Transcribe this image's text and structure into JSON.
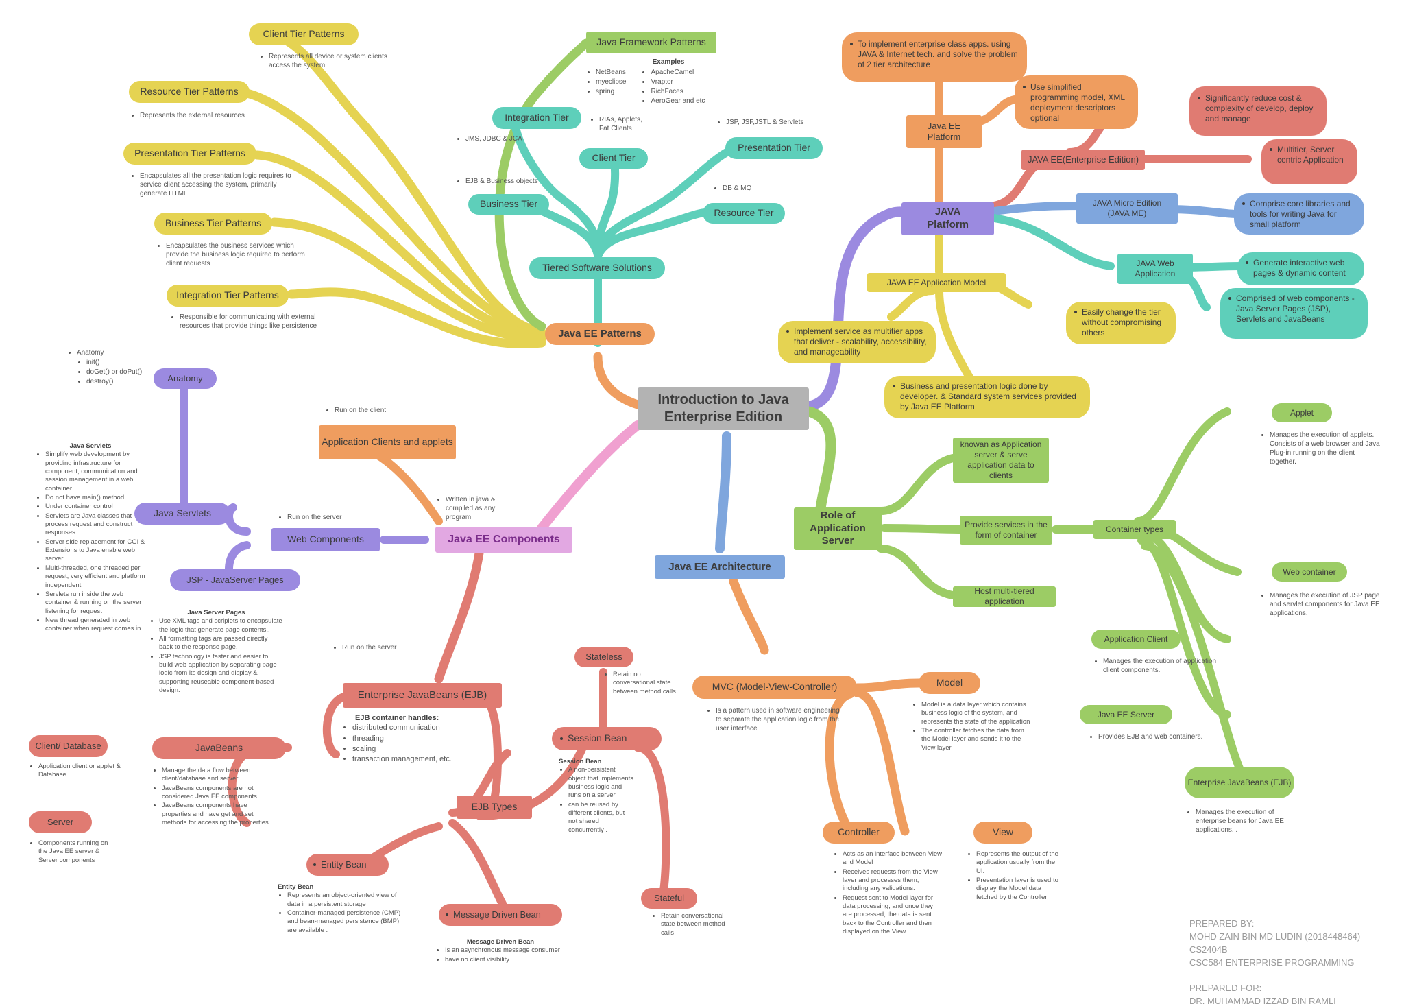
{
  "colors": {
    "yellow": "#e5d352",
    "yellow_soft": "#e4d04a",
    "green": "#9ccc65",
    "green_light": "#a5d46a",
    "teal": "#5ecfba",
    "teal2": "#63cfb8",
    "orange": "#ef9d5f",
    "orange2": "#eea064",
    "red": "#e07b72",
    "purple": "#9b8ae0",
    "purple2": "#a294e6",
    "blue": "#7fa6dd",
    "grey": "#b3b3b3",
    "text": "#3c3c3c",
    "note": "#555555"
  },
  "center": {
    "title": "Introduction to Java\nEnterprise Edition"
  },
  "branches": {
    "java_ee_patterns": {
      "label": "Java EE Patterns",
      "children": [
        {
          "label": "Client Tier Patterns",
          "notes": [
            "Represents all device or system clients access the system"
          ]
        },
        {
          "label": "Resource Tier Patterns",
          "notes": [
            "Represents the external resources"
          ]
        },
        {
          "label": "Presentation Tier Patterns",
          "notes": [
            "Encapsulates all the presentation logic requires to service client accessing the system, primarily generate HTML"
          ]
        },
        {
          "label": "Business Tier Patterns",
          "notes": [
            "Encapsulates the business services which provide the business logic required to perform client requests"
          ]
        },
        {
          "label": "Integration Tier Patterns",
          "notes": [
            "Responsible for communicating with external resources that provide things like persistence"
          ]
        }
      ]
    },
    "java_framework_patterns": {
      "label": "Java Framework Patterns",
      "examples_heading": "Examples",
      "examples_col1": [
        "NetBeans",
        "myeclipse",
        "spring"
      ],
      "examples_col2": [
        "ApacheCamel",
        "Vraptor",
        "RichFaces",
        "AeroGear and etc"
      ]
    },
    "tiered_software_solutions": {
      "label": "Tiered Software Solutions",
      "children": [
        {
          "label": "Integration Tier",
          "note": "JMS, JDBC & JCA"
        },
        {
          "label": "Client Tier",
          "note": "RIAs, Applets, Fat Clients"
        },
        {
          "label": "Business Tier",
          "note": "EJB & Business objects"
        },
        {
          "label": "Presentation Tier",
          "note": "JSP, JSF,JSTL & Servlets"
        },
        {
          "label": "Resource Tier",
          "note": "DB & MQ"
        }
      ]
    },
    "java_platform": {
      "label": "JAVA\nPlatform",
      "java_ee_platform": {
        "label": "Java EE\nPlatform",
        "notes": [
          "To implement enterprise class apps. using JAVA & Internet tech. and solve the problem of 2 tier architecture",
          "Use simplified programming model, XML deployment descriptors optional"
        ]
      },
      "java_ee_edition": {
        "label": "JAVA EE(Enterprise Edition)",
        "notes": [
          "Significantly reduce cost & complexity of develop, deploy and manage",
          "Multitier, Server centric Application"
        ]
      },
      "java_me": {
        "label": "JAVA Micro Edition\n(JAVA ME)",
        "notes": [
          "Comprise core libraries and tools for writing Java for small platform"
        ]
      },
      "java_web_app": {
        "label": "JAVA Web\nApplication",
        "notes": [
          "Generate interactive web pages & dynamic content",
          "Comprised of web components - Java Server Pages (JSP), Servlets and JavaBeans"
        ]
      },
      "app_model": {
        "label": "JAVA EE Application Model",
        "notes": [
          "Implement service as multitier apps that deliver - scalability, accessibility, and manageability",
          "Easily change the tier without compromising others",
          "Business and presentation logic done by developer. & Standard system services provided by Java EE Platform"
        ]
      }
    },
    "java_ee_components": {
      "label": "Java EE Components",
      "web_components": {
        "label": "Web Components",
        "edge_note": "Run on the server",
        "anatomy": {
          "label": "Anatomy",
          "notes_title": "Anatomy",
          "notes_sub": [
            "init()",
            "doGet() or doPut()",
            "destroy()"
          ]
        },
        "java_servlets": {
          "label": "Java Servlets",
          "notes_title": "Java Servlets",
          "notes": [
            "Simplify web development by providing infrastructure for component, communication and session management in a web container",
            "Do not have main() method",
            "Under container control",
            "Servlets are Java classes that process request and construct responses",
            "Server side replacement for CGI & Extensions to Java enable web server",
            "Multi-threaded, one threaded per request, very efficient and platform independent",
            "Servlets run inside the web container & running on the server listening for request",
            "New thread generated in web container when request comes in"
          ]
        },
        "jsp": {
          "label": "JSP - JavaServer Pages",
          "notes_title": "Java Server Pages",
          "notes": [
            "Use XML tags and scriplets to encapsulate the logic that generate page contents..",
            "All formatting tags are passed directly back to the response page.",
            "JSP technology is faster and easier to build web application by separating page logic from its design and display & supporting reuseable component-based design."
          ]
        }
      },
      "application_clients": {
        "label": "Application Clients and applets",
        "edge_note_client": "Run on the client",
        "edge_note_written": "Written in java & compiled as any program"
      },
      "ejb": {
        "label": "Enterprise JavaBeans (EJB)",
        "edge_note": "Run on the server",
        "notes_title": "EJB container handles:",
        "notes": [
          "distributed communication",
          "threading",
          "scaling",
          "transaction management, etc."
        ],
        "types": {
          "label": "EJB Types",
          "session_bean": {
            "label": "Session Bean",
            "notes_title": "Session Bean",
            "notes": [
              "A non-persistent object that implements business logic and runs on a server",
              "can be reused by different clients, but not shared concurrently ."
            ],
            "stateless": {
              "label": "Stateless",
              "notes": [
                "Retain no conversational state between method calls"
              ]
            },
            "stateful": {
              "label": "Stateful",
              "notes": [
                "Retain conversational state between method calls"
              ]
            }
          },
          "entity_bean": {
            "label": "Entity Bean",
            "notes_title": "Entity Bean",
            "notes": [
              "Represents an object-oriented view of data in a persistent storage",
              "Container-managed persistence (CMP) and bean-managed persistence (BMP) are available ."
            ]
          },
          "message_driven_bean": {
            "label": "Message Driven Bean",
            "notes_title": "Message Driven Bean",
            "notes": [
              "Is an asynchronous message consumer",
              "have no client visibility ."
            ]
          }
        }
      },
      "javabeans": {
        "label": "JavaBeans",
        "notes": [
          "Manage the data flow between client/database and server",
          "JavaBeans components are not considered Java EE components.",
          "JavaBeans components have properties and have get and set methods for accessing the properties"
        ],
        "client_database": {
          "label": "Client/ Database",
          "notes": [
            "Application client or applet & Database"
          ]
        },
        "server": {
          "label": "Server",
          "notes": [
            "Components running on the Java EE server & Server components"
          ]
        }
      }
    },
    "java_ee_architecture": {
      "label": "Java EE Architecture",
      "mvc": {
        "label": "MVC (Model-View-Controller)",
        "notes": [
          "Is a pattern used in software engineering to separate the application logic from the user interface"
        ],
        "model": {
          "label": "Model",
          "notes": [
            "Model is a data layer which contains business logic of the system, and represents the state of the application",
            "The controller fetches the data from the Model layer and sends it to the View layer."
          ]
        },
        "view": {
          "label": "View",
          "notes": [
            "Represents the output of the application usually from the UI.",
            "Presentation layer is used to display the Model data fetched by the Controller"
          ]
        },
        "controller": {
          "label": "Controller",
          "notes": [
            "Acts as an interface between View and Model",
            "Receives requests from the View layer and processes them, including any validations.",
            "Request sent to Model layer for data processing, and once they are processed, the data is sent back to the Controller and then displayed on the View"
          ]
        }
      }
    },
    "role_of_application_server": {
      "label": "Role of Application Server",
      "children": [
        {
          "label": "knowan as Application server & serve application data to clients"
        },
        {
          "label": "Provide services in the form of container"
        },
        {
          "label": "Host multi-tiered application"
        }
      ],
      "container_types": {
        "label": "Container types",
        "children": [
          {
            "label": "Applet",
            "notes": [
              "Manages the execution of applets. Consists of a web browser and Java Plug-in running on the client together."
            ]
          },
          {
            "label": "Web container",
            "notes": [
              "Manages the execution of JSP page and servlet components for Java EE applications."
            ]
          },
          {
            "label": "Application Client",
            "notes": [
              "Manages the execution of application client components."
            ]
          },
          {
            "label": "Java EE Server",
            "notes": [
              "Provides EJB and web containers."
            ]
          },
          {
            "label": "Enterprise JavaBeans (EJB)",
            "notes": [
              "Manages the execution of enterprise beans for Java EE applications. ."
            ]
          }
        ]
      }
    }
  },
  "footer": {
    "text": "PREPARED BY:\nMOHD ZAIN BIN MD LUDIN (2018448464) CS2404B\nCSC584 ENTERPRISE PROGRAMMING\n\nPREPARED FOR:\nDR. MUHAMMAD IZZAD BIN RAMLI"
  }
}
